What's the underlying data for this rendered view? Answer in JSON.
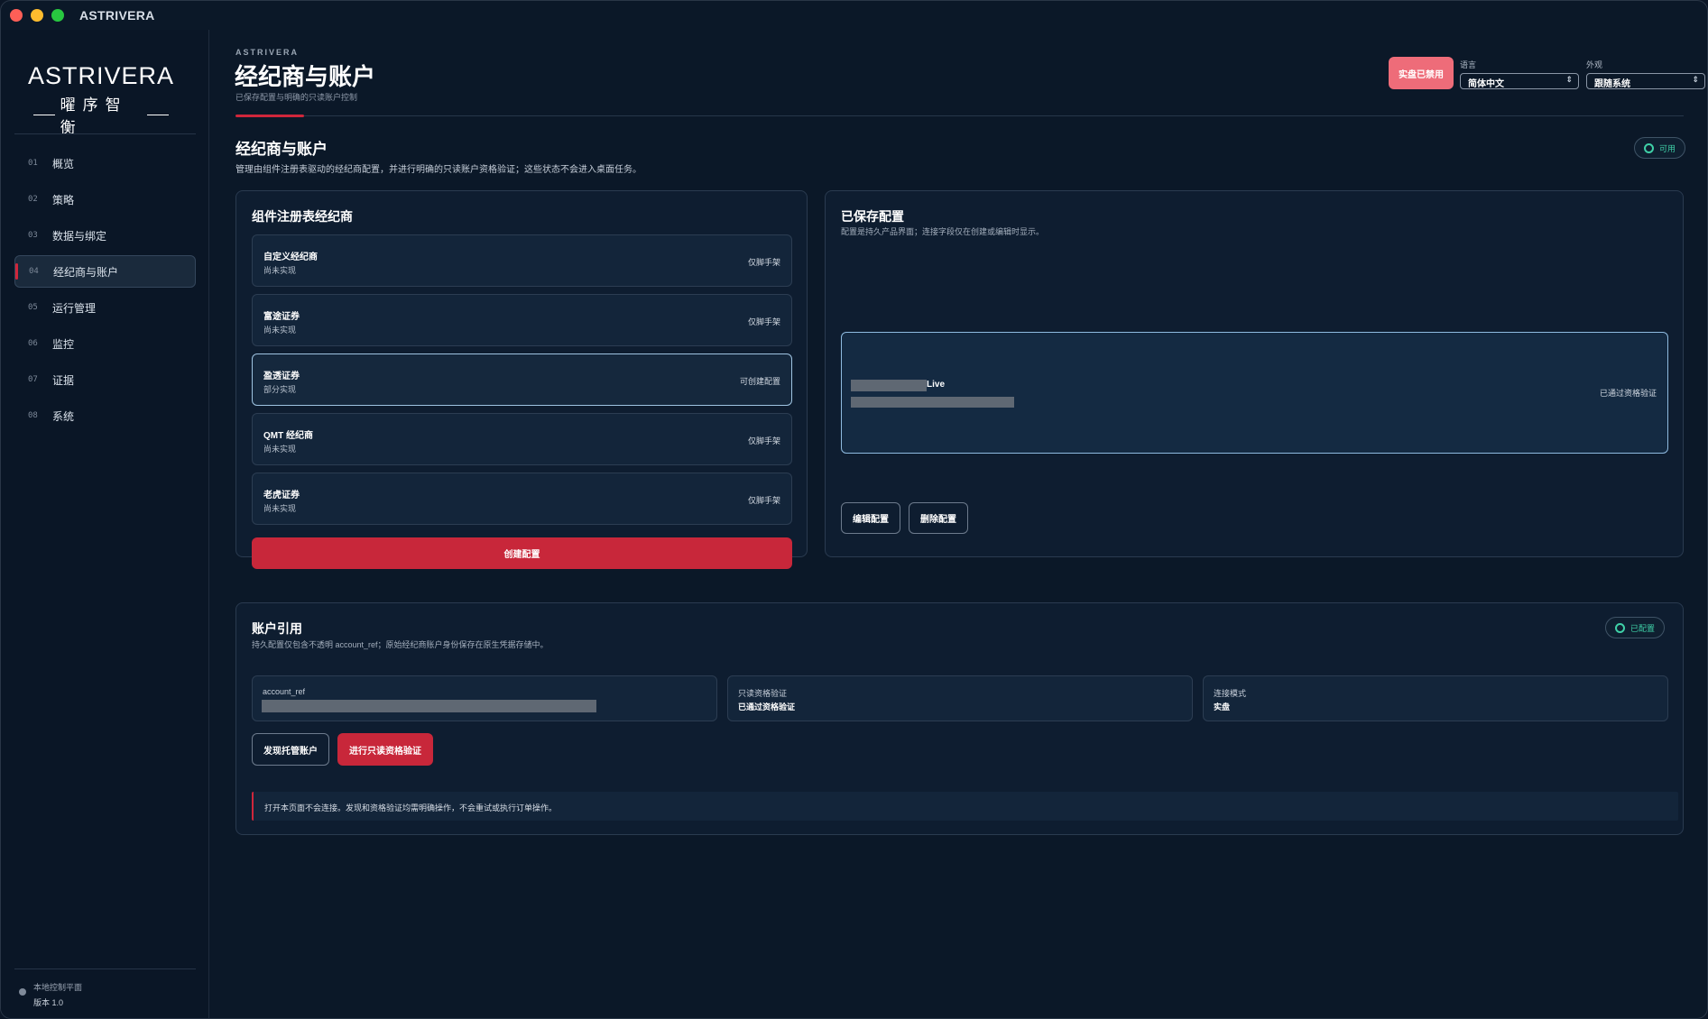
{
  "window": {
    "title": "ASTRIVERA"
  },
  "sidebar": {
    "logo": {
      "wordmark": "ASTRIVERA",
      "subtitle": "曜序智衡"
    },
    "items": [
      {
        "num": "01",
        "label": "概览"
      },
      {
        "num": "02",
        "label": "策略"
      },
      {
        "num": "03",
        "label": "数据与绑定"
      },
      {
        "num": "04",
        "label": "经纪商与账户"
      },
      {
        "num": "05",
        "label": "运行管理"
      },
      {
        "num": "06",
        "label": "监控"
      },
      {
        "num": "07",
        "label": "证据"
      },
      {
        "num": "08",
        "label": "系统"
      }
    ],
    "active_index": 3,
    "footer": {
      "line1": "本地控制平面",
      "line2": "版本 1.0"
    }
  },
  "header": {
    "eyebrow": "ASTRIVERA",
    "title": "经纪商与账户",
    "subtitle": "已保存配置与明确的只读账户控制",
    "live_pill": "实盘已禁用",
    "language": {
      "label": "语言",
      "value": "简体中文"
    },
    "appearance": {
      "label": "外观",
      "value": "跟随系统"
    }
  },
  "section": {
    "title": "经纪商与账户",
    "description": "管理由组件注册表驱动的经纪商配置，并进行明确的只读账户资格验证；这些状态不会进入桌面任务。",
    "badge": "可用"
  },
  "registry": {
    "title": "组件注册表经纪商",
    "brokers": [
      {
        "name": "自定义经纪商",
        "status": "尚未实现",
        "tag": "仅脚手架"
      },
      {
        "name": "富途证券",
        "status": "尚未实现",
        "tag": "仅脚手架"
      },
      {
        "name": "盈透证券",
        "status": "部分实现",
        "tag": "可创建配置"
      },
      {
        "name": "QMT 经纪商",
        "status": "尚未实现",
        "tag": "仅脚手架"
      },
      {
        "name": "老虎证券",
        "status": "尚未实现",
        "tag": "仅脚手架"
      }
    ],
    "create_button": "创建配置"
  },
  "saved_configs": {
    "title": "已保存配置",
    "description": "配置是持久产品界面；连接字段仅在创建或编辑时显示。",
    "item": {
      "name_suffix": "Live",
      "status": "已通过资格验证"
    },
    "edit_button": "编辑配置",
    "delete_button": "删除配置"
  },
  "account": {
    "title": "账户引用",
    "description": "持久配置仅包含不透明 account_ref；原始经纪商账户身份保存在原生凭据存储中。",
    "badge": "已配置",
    "fields": [
      {
        "label": "account_ref",
        "value": ""
      },
      {
        "label": "只读资格验证",
        "value": "已通过资格验证"
      },
      {
        "label": "连接模式",
        "value": "实盘"
      }
    ],
    "discover_button": "发现托管账户",
    "verify_button": "进行只读资格验证",
    "notice": "打开本页面不会连接。发现和资格验证均需明确操作，不会重试或执行订单操作。"
  }
}
